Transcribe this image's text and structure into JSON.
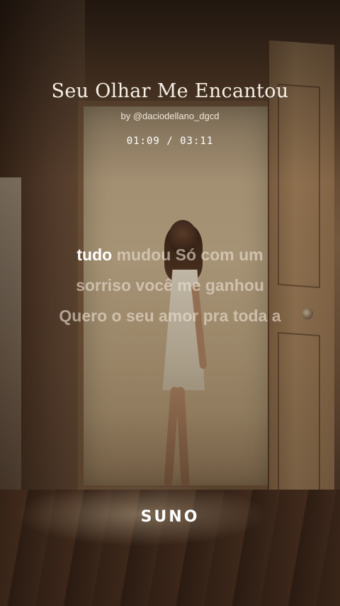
{
  "song": {
    "title": "Seu Olhar Me Encantou",
    "artist": "by @daciodellano_dgcd",
    "time_display": "01:09 / 03:11"
  },
  "lyrics": {
    "line1_active": "tudo",
    "line1_rest": " mudou Só com um",
    "line2": "sorriso você me ganhou",
    "line3": "Quero o seu amor pra toda a"
  },
  "brand": {
    "logo_text": "SUNO"
  }
}
